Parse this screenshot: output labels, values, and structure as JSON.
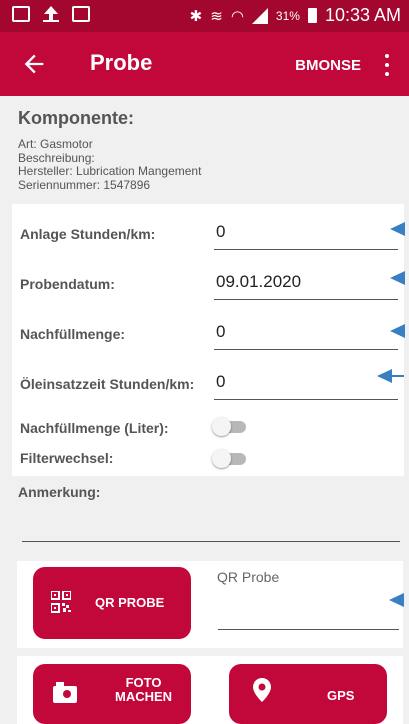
{
  "statusbar": {
    "battery": "31%",
    "time": "10:33 AM"
  },
  "appbar": {
    "title": "Probe",
    "user": "BMONSE"
  },
  "component": {
    "heading": "Komponente:",
    "art": "Art: Gasmotor",
    "beschreibung": "Beschreibung:",
    "hersteller": "Hersteller: Lubrication Mangement",
    "seriennummer": "Seriennummer: 1547896"
  },
  "form": {
    "anlage_label": "Anlage Stunden/km:",
    "anlage_value": "0",
    "probendatum_label": "Probendatum:",
    "probendatum_value": "09.01.2020",
    "nachfuell_label": "Nachfüllmenge:",
    "nachfuell_value": "0",
    "oeleinsatz_label": "Öleinsatzzeit Stunden/km:",
    "oeleinsatz_value": "0",
    "nachfuell_liter_label": "Nachfüllmenge (Liter):",
    "nachfuell_liter_on": false,
    "filterwechsel_label": "Filterwechsel:",
    "filterwechsel_on": false
  },
  "note": {
    "label": "Anmerkung:",
    "value": ""
  },
  "qr": {
    "button_label": "QR PROBE",
    "field_label": "QR Probe",
    "field_value": ""
  },
  "actions": {
    "foto_line1": "FOTO",
    "foto_line2": "MACHEN",
    "gps_label": "GPS"
  },
  "colors": {
    "statusbar": "#a3062f",
    "primary": "#c2073b",
    "annotation_arrow": "#3a7fc1"
  },
  "icons": [
    "back-arrow-icon",
    "more-vert-icon",
    "qr-code-icon",
    "camera-icon",
    "location-pin-icon",
    "bluetooth-icon",
    "wifi-icon",
    "signal-icon",
    "battery-icon"
  ]
}
